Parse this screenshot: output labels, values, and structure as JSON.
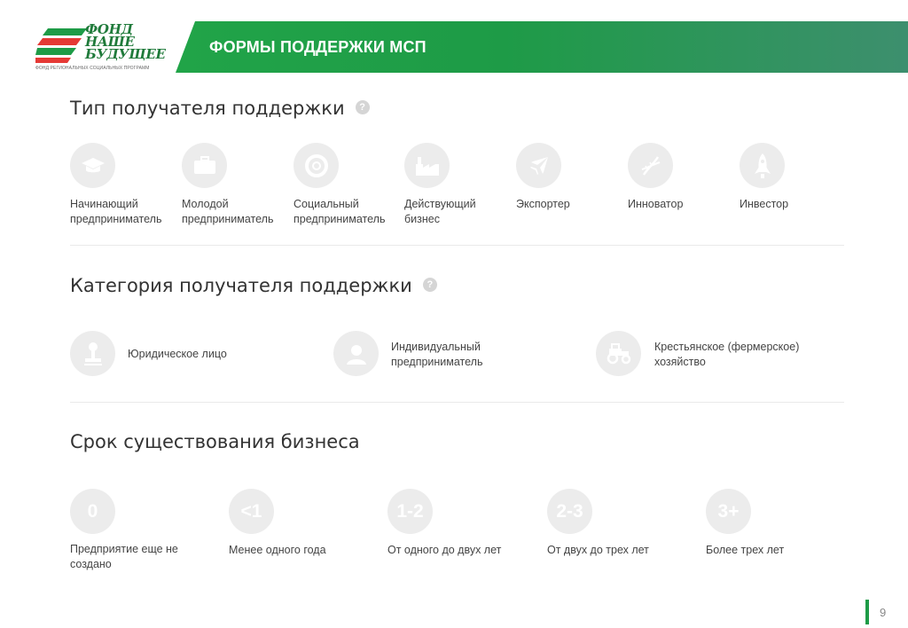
{
  "logo": {
    "line1": "ФОНД",
    "line2": "НАШЕ",
    "line3": "БУДУЩЕЕ",
    "subtitle": "ФОНД РЕГИОНАЛЬНЫХ СОЦИАЛЬНЫХ ПРОГРАММ"
  },
  "header": {
    "title": "ФОРМЫ ПОДДЕРЖКИ МСП"
  },
  "section1": {
    "title": "Тип получателя поддержки",
    "help": "?",
    "items": [
      {
        "icon": "graduation-cap-icon",
        "label": "Начинающий\nпредприниматель"
      },
      {
        "icon": "briefcase-icon",
        "label": "Молодой\nпредприниматель"
      },
      {
        "icon": "lifebuoy-icon",
        "label": "Социальный\nпредприниматель"
      },
      {
        "icon": "factory-icon",
        "label": "Действующий\nбизнес"
      },
      {
        "icon": "airplane-icon",
        "label": "Экспортер"
      },
      {
        "icon": "dna-icon",
        "label": "Инноватор"
      },
      {
        "icon": "rocket-icon",
        "label": "Инвестор"
      }
    ]
  },
  "section2": {
    "title": "Категория получателя поддержки",
    "help": "?",
    "items": [
      {
        "icon": "stamp-icon",
        "label": "Юридическое лицо"
      },
      {
        "icon": "person-icon",
        "label": "Индивидуальный\nпредприниматель"
      },
      {
        "icon": "tractor-icon",
        "label": "Крестьянское (фермерское)\nхозяйство"
      }
    ]
  },
  "section3": {
    "title": "Срок существования бизнеса",
    "items": [
      {
        "badge": "0",
        "label": "Предприятие еще не\nсоздано"
      },
      {
        "badge": "<1",
        "label": "Менее одного года"
      },
      {
        "badge": "1-2",
        "label": "От одного до двух лет"
      },
      {
        "badge": "2-3",
        "label": "От двух до трех лет"
      },
      {
        "badge": "3+",
        "label": "Более трех лет"
      }
    ]
  },
  "page": {
    "number": "9"
  },
  "colors": {
    "accent": "#1e9b47",
    "icon_bg": "#ececec",
    "icon_fg": "#ffffff"
  }
}
